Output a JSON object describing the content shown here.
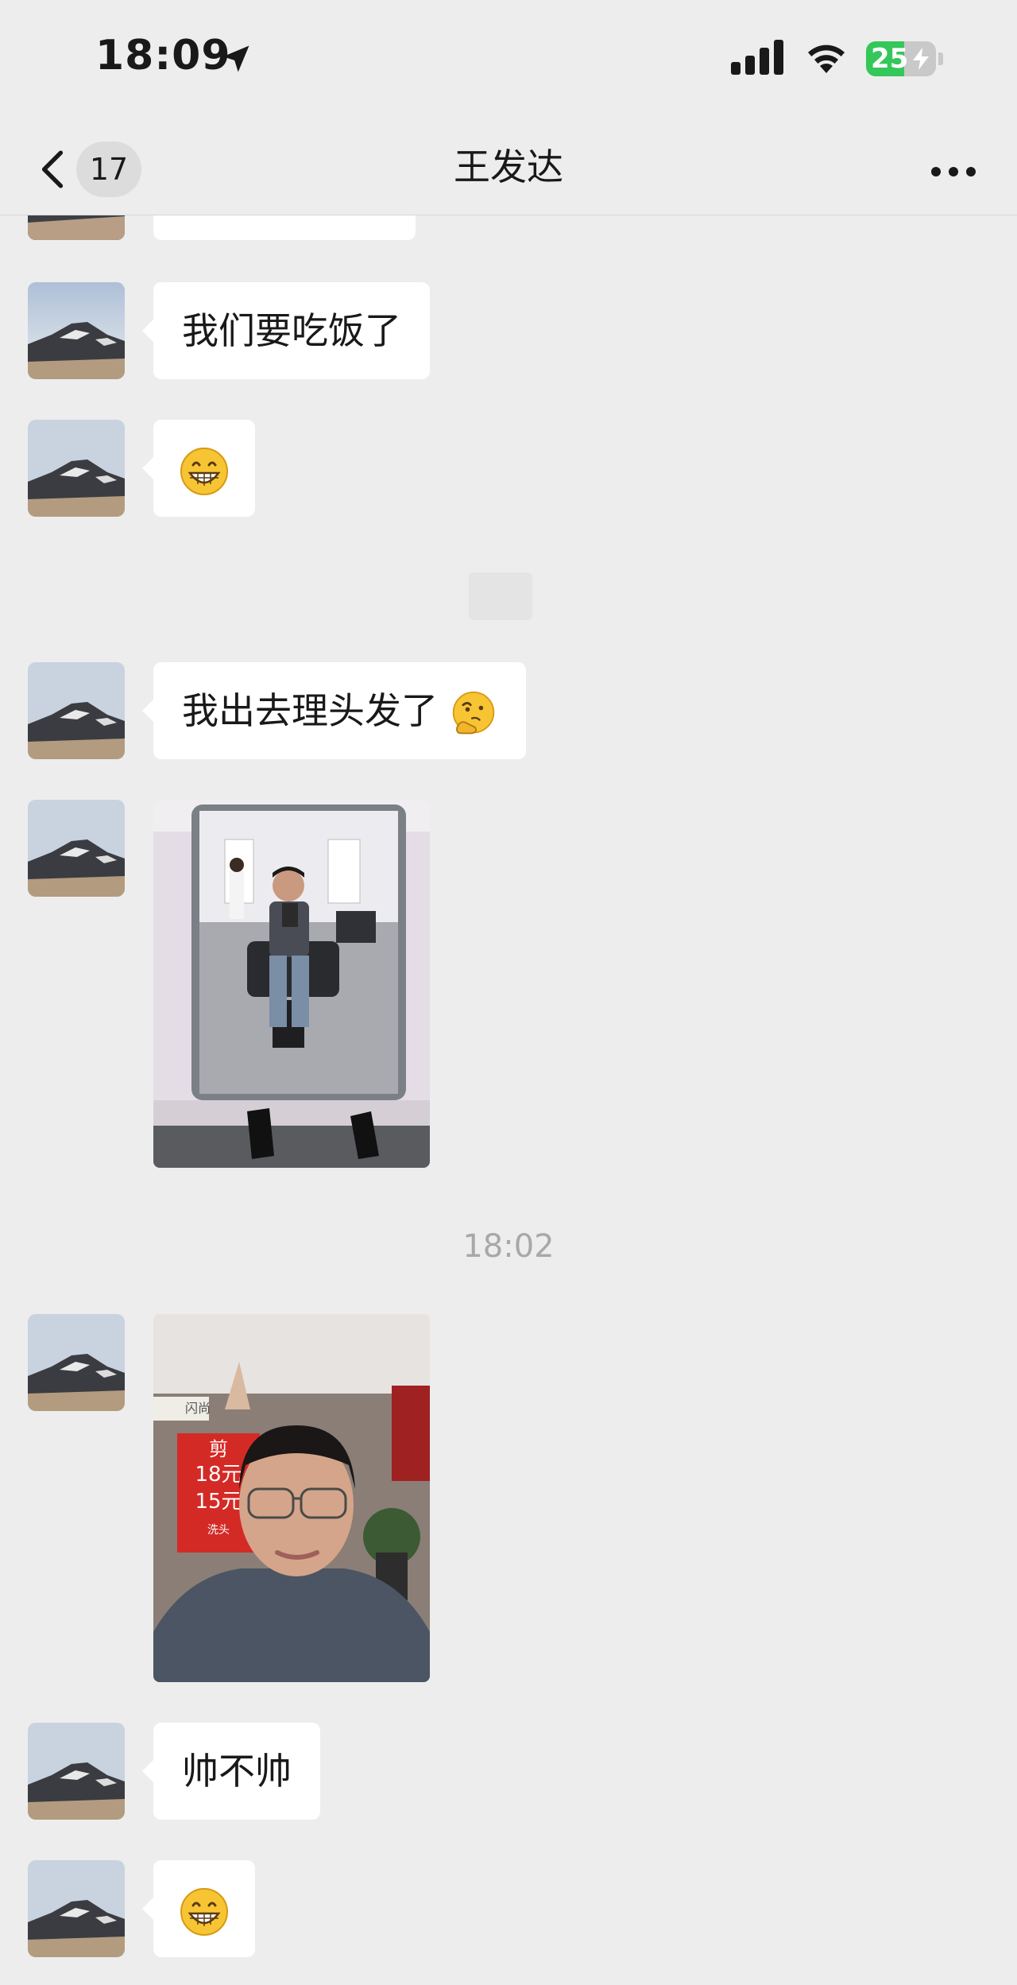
{
  "status_bar": {
    "time": "18:09",
    "battery_level": 25,
    "battery_text": "25",
    "icons": [
      "location-arrow-icon",
      "cellular-signal-icon",
      "wifi-icon",
      "battery-charging-icon"
    ]
  },
  "nav": {
    "back_icon": "chevron-left-icon",
    "unread_count": "17",
    "title": "王发达",
    "more_icon": "more-dots-icon"
  },
  "messages": [
    {
      "type": "text",
      "text": "我们要吃饭了"
    },
    {
      "type": "emoji",
      "icon": "grinning-face-icon"
    },
    {
      "type": "text",
      "text": "我出去理头发了",
      "emoji": "thinking-face-icon"
    },
    {
      "type": "image",
      "description_icon": "barbershop-mirror-photo"
    },
    {
      "type": "image",
      "description_icon": "selfie-photo"
    },
    {
      "type": "text",
      "text": "帅不帅"
    },
    {
      "type": "emoji",
      "icon": "grinning-face-icon"
    }
  ],
  "timestamp": "18:02",
  "photo_sign": {
    "line1": "剪",
    "line2": "18元",
    "line3": "15元",
    "line4": "洗头",
    "shop": "闪尚"
  },
  "colors": {
    "background": "#ededed",
    "bubble": "#ffffff",
    "battery": "#34c759",
    "timestamp": "#a8a8a8"
  }
}
